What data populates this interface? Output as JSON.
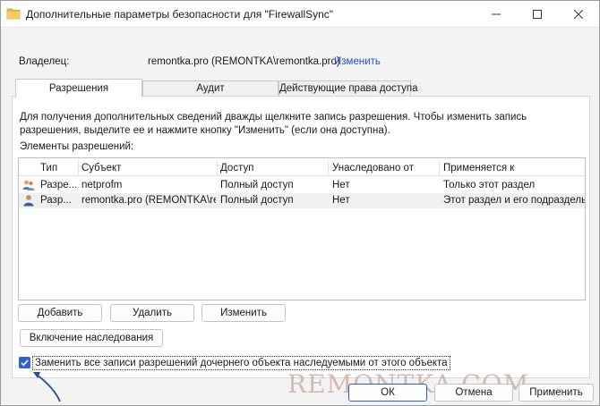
{
  "window": {
    "title": "Дополнительные параметры безопасности  для \"FirewallSync\""
  },
  "owner": {
    "label": "Владелец:",
    "value": "remontka.pro (REMONTKA\\remontka.pro)",
    "change_link": "Изменить"
  },
  "tabs": [
    {
      "label": "Разрешения",
      "active": true
    },
    {
      "label": "Аудит",
      "active": false
    },
    {
      "label": "Действующие права доступа",
      "active": false
    }
  ],
  "permissions": {
    "description": "Для получения дополнительных сведений дважды щелкните запись разрешения. Чтобы изменить запись разрешения, выделите ее и нажмите кнопку \"Изменить\" (если она доступна).",
    "entries_label": "Элементы разрешений:",
    "columns": [
      "Тип",
      "Субъект",
      "Доступ",
      "Унаследовано от",
      "Применяется к"
    ],
    "rows": [
      {
        "icon": "users-group-icon",
        "type": "Разре...",
        "subject": "netprofm",
        "access": "Полный доступ",
        "inherited": "Нет",
        "applies": "Только этот раздел",
        "selected": false
      },
      {
        "icon": "user-icon",
        "type": "Разр...",
        "subject": "remontka.pro (REMONTKA\\remontka.pr...",
        "access": "Полный доступ",
        "inherited": "Нет",
        "applies": "Этот раздел и его подразделы",
        "selected": true
      }
    ],
    "buttons": {
      "add": "Добавить",
      "remove": "Удалить",
      "edit": "Изменить",
      "enable_inheritance": "Включение наследования"
    },
    "replace_checkbox": {
      "label": "Заменить все записи разрешений дочернего объекта наследуемыми от этого объекта",
      "checked": true
    }
  },
  "footer": {
    "ok": "ОК",
    "cancel": "Отмена",
    "apply": "Применить"
  },
  "watermark": "REMONTKA.COM",
  "colors": {
    "accent": "#2c5fd4",
    "link": "#1a4fd6",
    "selected_row": "#f0f0f0",
    "watermark": "#c9a79b"
  }
}
